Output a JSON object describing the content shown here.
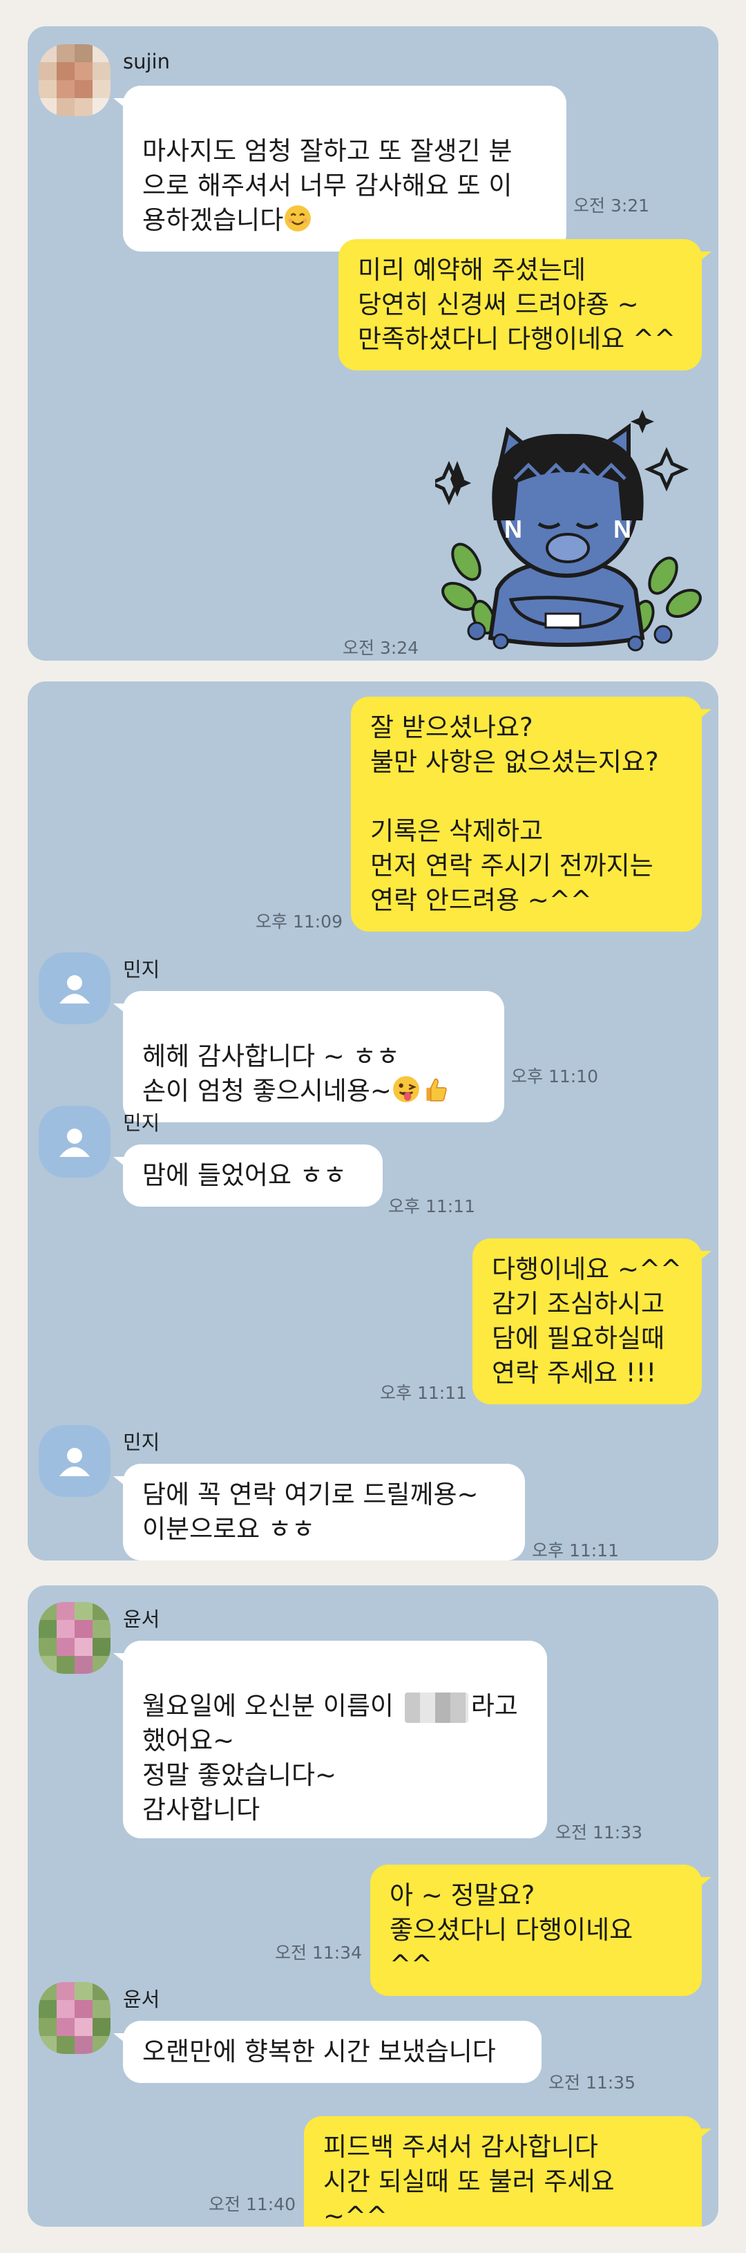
{
  "panel1": {
    "sender": "sujin",
    "msg1": "마사지도 엄청 잘하고 또 잘생긴 분\n으로 해주셔서 너무 감사해요 또 이\n용하겠습니다",
    "msg1_emoji": "smiling-face-icon",
    "time1": "오전 3:21",
    "reply1": "미리 예약해 주셨는데\n당연히 신경써 드려야죵 ~\n만족하셨다니 다행이네요 ^^",
    "sticker": "lion-character-sticker",
    "time2": "오전 3:24"
  },
  "panel2": {
    "out1": "잘 받으셨나요?\n불만 사항은 없으셨는지요?\n\n기록은 삭제하고\n먼저 연락 주시기 전까지는\n연락 안드려용 ~^^",
    "time_out1": "오후 11:09",
    "sender": "민지",
    "in1": "헤헤 감사합니다 ~ ㅎㅎ\n손이 엄청 좋으시네용~",
    "in1_emojis": [
      "winking-face-tongue-icon",
      "thumbs-up-icon"
    ],
    "time_in1": "오후 11:10",
    "in2": "맘에 들었어요 ㅎㅎ",
    "time_in2": "오후 11:11",
    "out2": "다행이네요 ~^^\n감기 조심하시고\n담에 필요하실때\n연락 주세요 !!!",
    "time_out2": "오후 11:11",
    "in3": "담에 꼭 연락 여기로 드릴께용~\n이분으로요 ㅎㅎ",
    "time_in3": "오후 11:11"
  },
  "panel3": {
    "sender": "윤서",
    "in1_a": "월요일에 오신분 이름이",
    "in1_b": "라고",
    "in1_rest": "했어요~\n정말 좋았습니다~\n감사합니다",
    "time_in1": "오전 11:33",
    "out1": "아 ~ 정말요?\n좋으셨다니 다행이네요 ^^",
    "time_out1": "오전 11:34",
    "in2": "오랜만에 향복한 시간 보냈습니다",
    "time_in2": "오전 11:35",
    "out2": "피드백 주셔서 감사합니다\n시간 되실때 또 불러 주세요 ~^^",
    "time_out2": "오전 11:40"
  },
  "colors": {
    "chat_bg": "#b3c7d9",
    "outgoing_bubble": "#fde93f",
    "incoming_bubble": "#ffffff",
    "page_bg": "#f2efea"
  }
}
